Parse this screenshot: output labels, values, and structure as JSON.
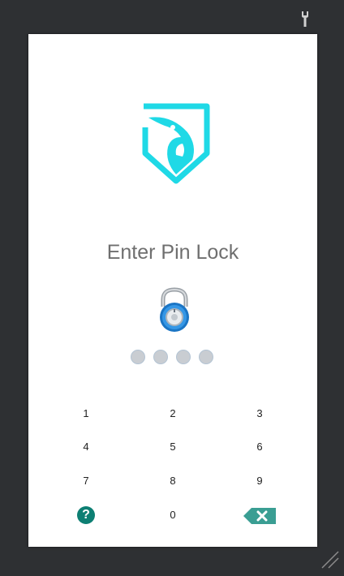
{
  "screen": {
    "title": "Enter Pin Lock",
    "pin_dots": [
      false,
      false,
      false,
      false
    ]
  },
  "keypad": {
    "keys": [
      {
        "label": "1"
      },
      {
        "label": "2"
      },
      {
        "label": "3"
      },
      {
        "label": "4"
      },
      {
        "label": "5"
      },
      {
        "label": "6"
      },
      {
        "label": "7"
      },
      {
        "label": "8"
      },
      {
        "label": "9"
      },
      {
        "label": "0"
      }
    ],
    "help_glyph": "?",
    "backspace_glyph": "✕"
  },
  "icons": {
    "toolbar": "wrench-icon",
    "logo": "eagle-shield-icon",
    "lock": "combination-padlock-icon",
    "help": "question-circle-icon",
    "backspace": "backspace-icon",
    "resize": "resize-grip-icon"
  },
  "colors": {
    "background": "#2e3033",
    "logo": "#1fd9e6",
    "accent": "#0d7f73",
    "backspace": "#3a9e93",
    "title_text": "#6f6f6f",
    "pin_dot": "#c9cdd2"
  }
}
